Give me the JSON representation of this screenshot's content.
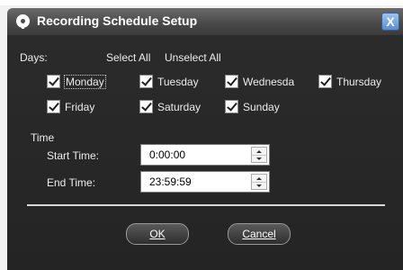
{
  "window": {
    "title": "Recording Schedule Setup",
    "close_label": "X"
  },
  "days": {
    "label": "Days:",
    "select_all": "Select All",
    "unselect_all": "Unselect All",
    "items": [
      {
        "label": "Monday",
        "checked": true
      },
      {
        "label": "Tuesday",
        "checked": true
      },
      {
        "label": "Wednesda",
        "checked": true
      },
      {
        "label": "Thursday",
        "checked": true
      },
      {
        "label": "Friday",
        "checked": true
      },
      {
        "label": "Saturday",
        "checked": true
      },
      {
        "label": "Sunday",
        "checked": true
      }
    ]
  },
  "time": {
    "section_label": "Time",
    "start_label": "Start Time:",
    "start_value": "0:00:00",
    "end_label": "End Time:",
    "end_value": "23:59:59"
  },
  "buttons": {
    "ok": "OK",
    "cancel": "Cancel"
  }
}
